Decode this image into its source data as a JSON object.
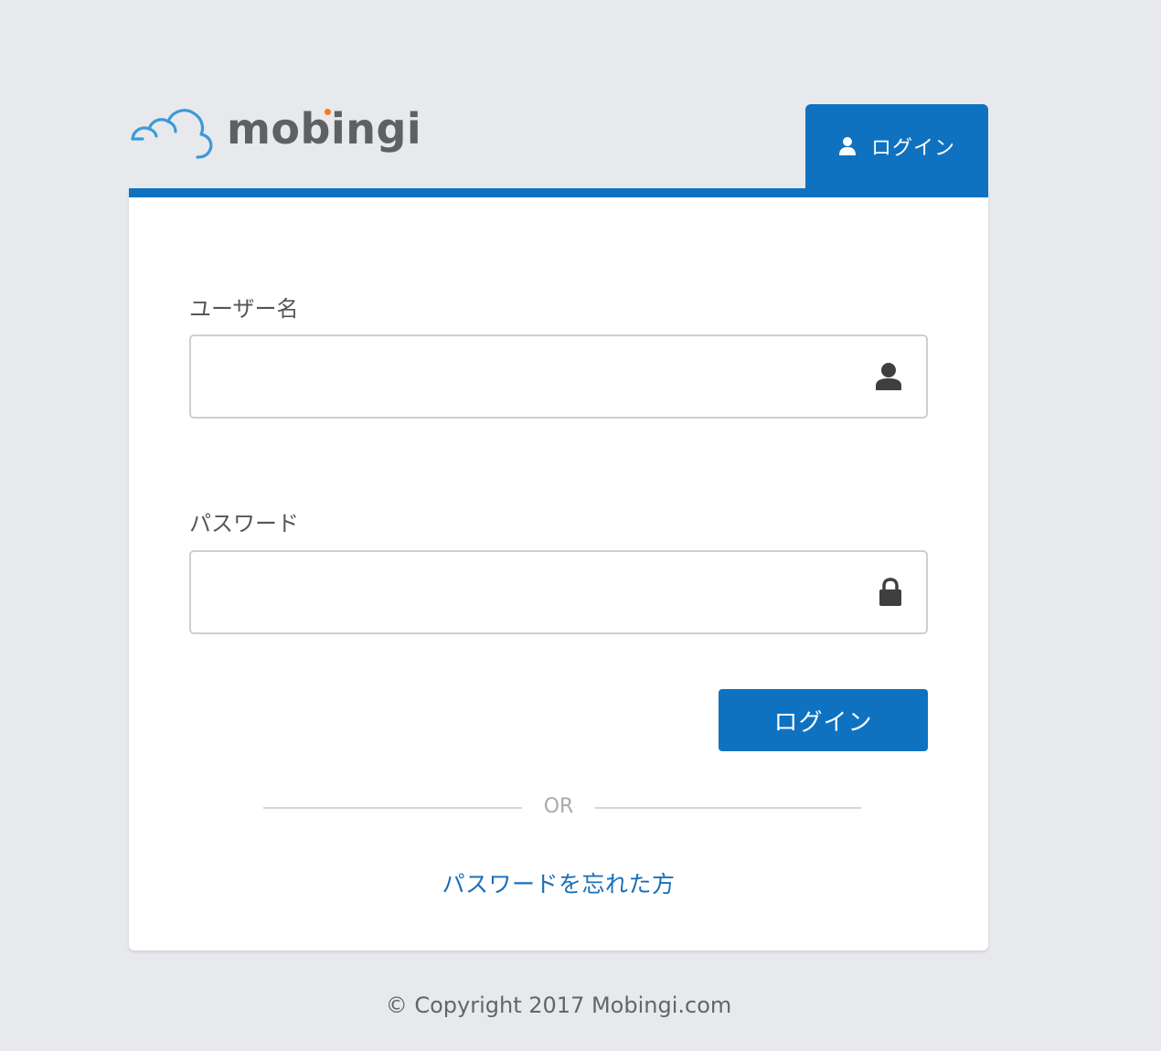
{
  "brand": {
    "name": "mobingi",
    "accent_color": "#0f72c1",
    "dot_color": "#f47b20",
    "cloud_icon": "cloud-icon"
  },
  "tab": {
    "icon": "user-icon",
    "label": "ログイン"
  },
  "form": {
    "username": {
      "label": "ユーザー名",
      "value": "",
      "placeholder": "",
      "icon": "user-icon"
    },
    "password": {
      "label": "パスワード",
      "value": "",
      "placeholder": "",
      "icon": "lock-icon"
    },
    "submit_label": "ログイン",
    "divider_text": "OR",
    "forgot_label": "パスワードを忘れた方"
  },
  "footer": {
    "copyright": "© Copyright 2017 Mobingi.com"
  }
}
